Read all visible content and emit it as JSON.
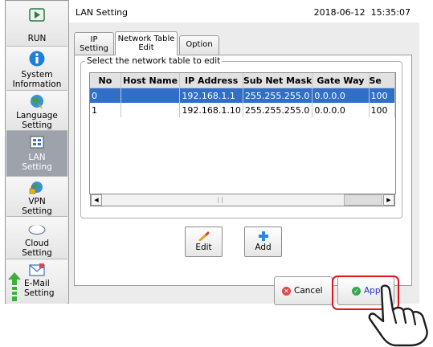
{
  "sidebar": {
    "items": [
      {
        "label": "RUN",
        "icon": "run-icon"
      },
      {
        "label": "System\nInformation",
        "icon": "info-icon"
      },
      {
        "label": "Language\nSetting",
        "icon": "language-icon"
      },
      {
        "label": "LAN\nSetting",
        "icon": "lan-icon",
        "active": true
      },
      {
        "label": "VPN\nSetting",
        "icon": "vpn-icon"
      },
      {
        "label": "Cloud\nSetting",
        "icon": "cloud-icon"
      },
      {
        "label": "E-Mail\nSetting",
        "icon": "email-icon"
      }
    ]
  },
  "header": {
    "title": "LAN Setting",
    "datetime": "2018-06-12  15:35:07"
  },
  "tabs": [
    {
      "label": "IP\nSetting"
    },
    {
      "label": "Network Table\nEdit",
      "active": true
    },
    {
      "label": "Option"
    }
  ],
  "group": {
    "label": "Select the network table to edit"
  },
  "table": {
    "columns": [
      "No",
      "Host Name",
      "IP Address",
      "Sub Net Mask",
      "Gate Way",
      "Se"
    ],
    "rows": [
      {
        "no": "0",
        "host": "",
        "ip": "192.168.1.1",
        "mask": "255.255.255.0",
        "gw": "0.0.0.0",
        "se": "100",
        "selected": true
      },
      {
        "no": "1",
        "host": "",
        "ip": "192.168.1.10",
        "mask": "255.255.255.0",
        "gw": "0.0.0.0",
        "se": "100",
        "selected": false
      }
    ]
  },
  "actions": {
    "edit_label": "Edit",
    "add_label": "Add"
  },
  "footer": {
    "cancel_label": "Cancel",
    "apply_label": "Apply"
  },
  "colors": {
    "selection": "#2f6ec9",
    "highlight": "#e0141d",
    "cancel": "#e04848",
    "apply": "#34a853"
  }
}
